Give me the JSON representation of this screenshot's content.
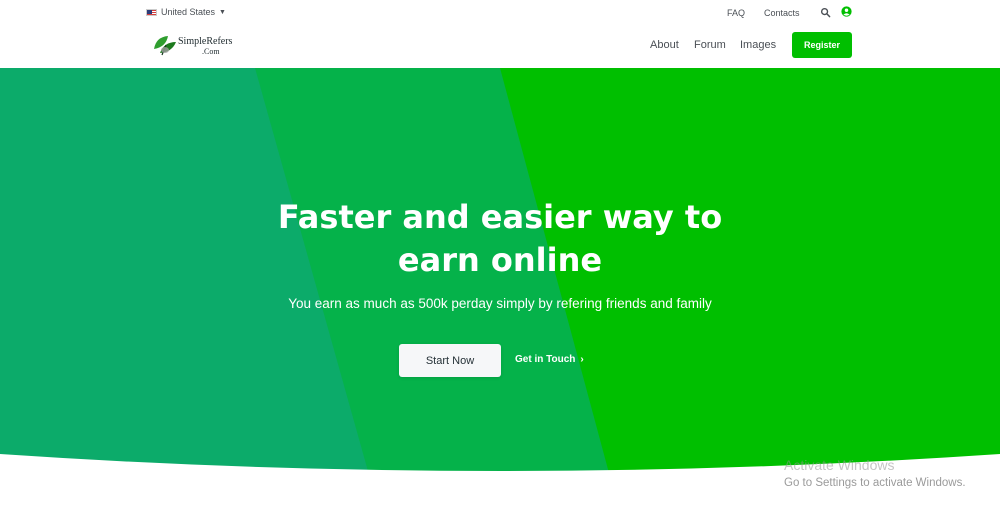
{
  "topbar": {
    "locale": "United States",
    "links": [
      "FAQ",
      "Contacts"
    ],
    "icons": [
      "search-icon",
      "user-icon"
    ]
  },
  "brand": {
    "logo_line1": "SimpleRefers",
    "logo_line2": ".Com"
  },
  "nav": {
    "items": [
      "About",
      "Forum",
      "Images"
    ],
    "register_label": "Register"
  },
  "hero": {
    "title_line1": "Faster and easier way to",
    "title_line2": "earn online",
    "subtitle": "You earn as much as 500k perday simply by refering friends and family",
    "primary_button": "Start Now",
    "secondary_button": "Get in Touch",
    "secondary_icon": "chevron-right-icon"
  },
  "watermark": {
    "title": "Activate Windows",
    "subtitle": "Go to Settings to activate Windows."
  },
  "colors": {
    "accent_green": "#00bf00",
    "hero_left": "#0cab6a",
    "hero_mid": "#05b24a",
    "text_dark": "#4a4f55"
  }
}
